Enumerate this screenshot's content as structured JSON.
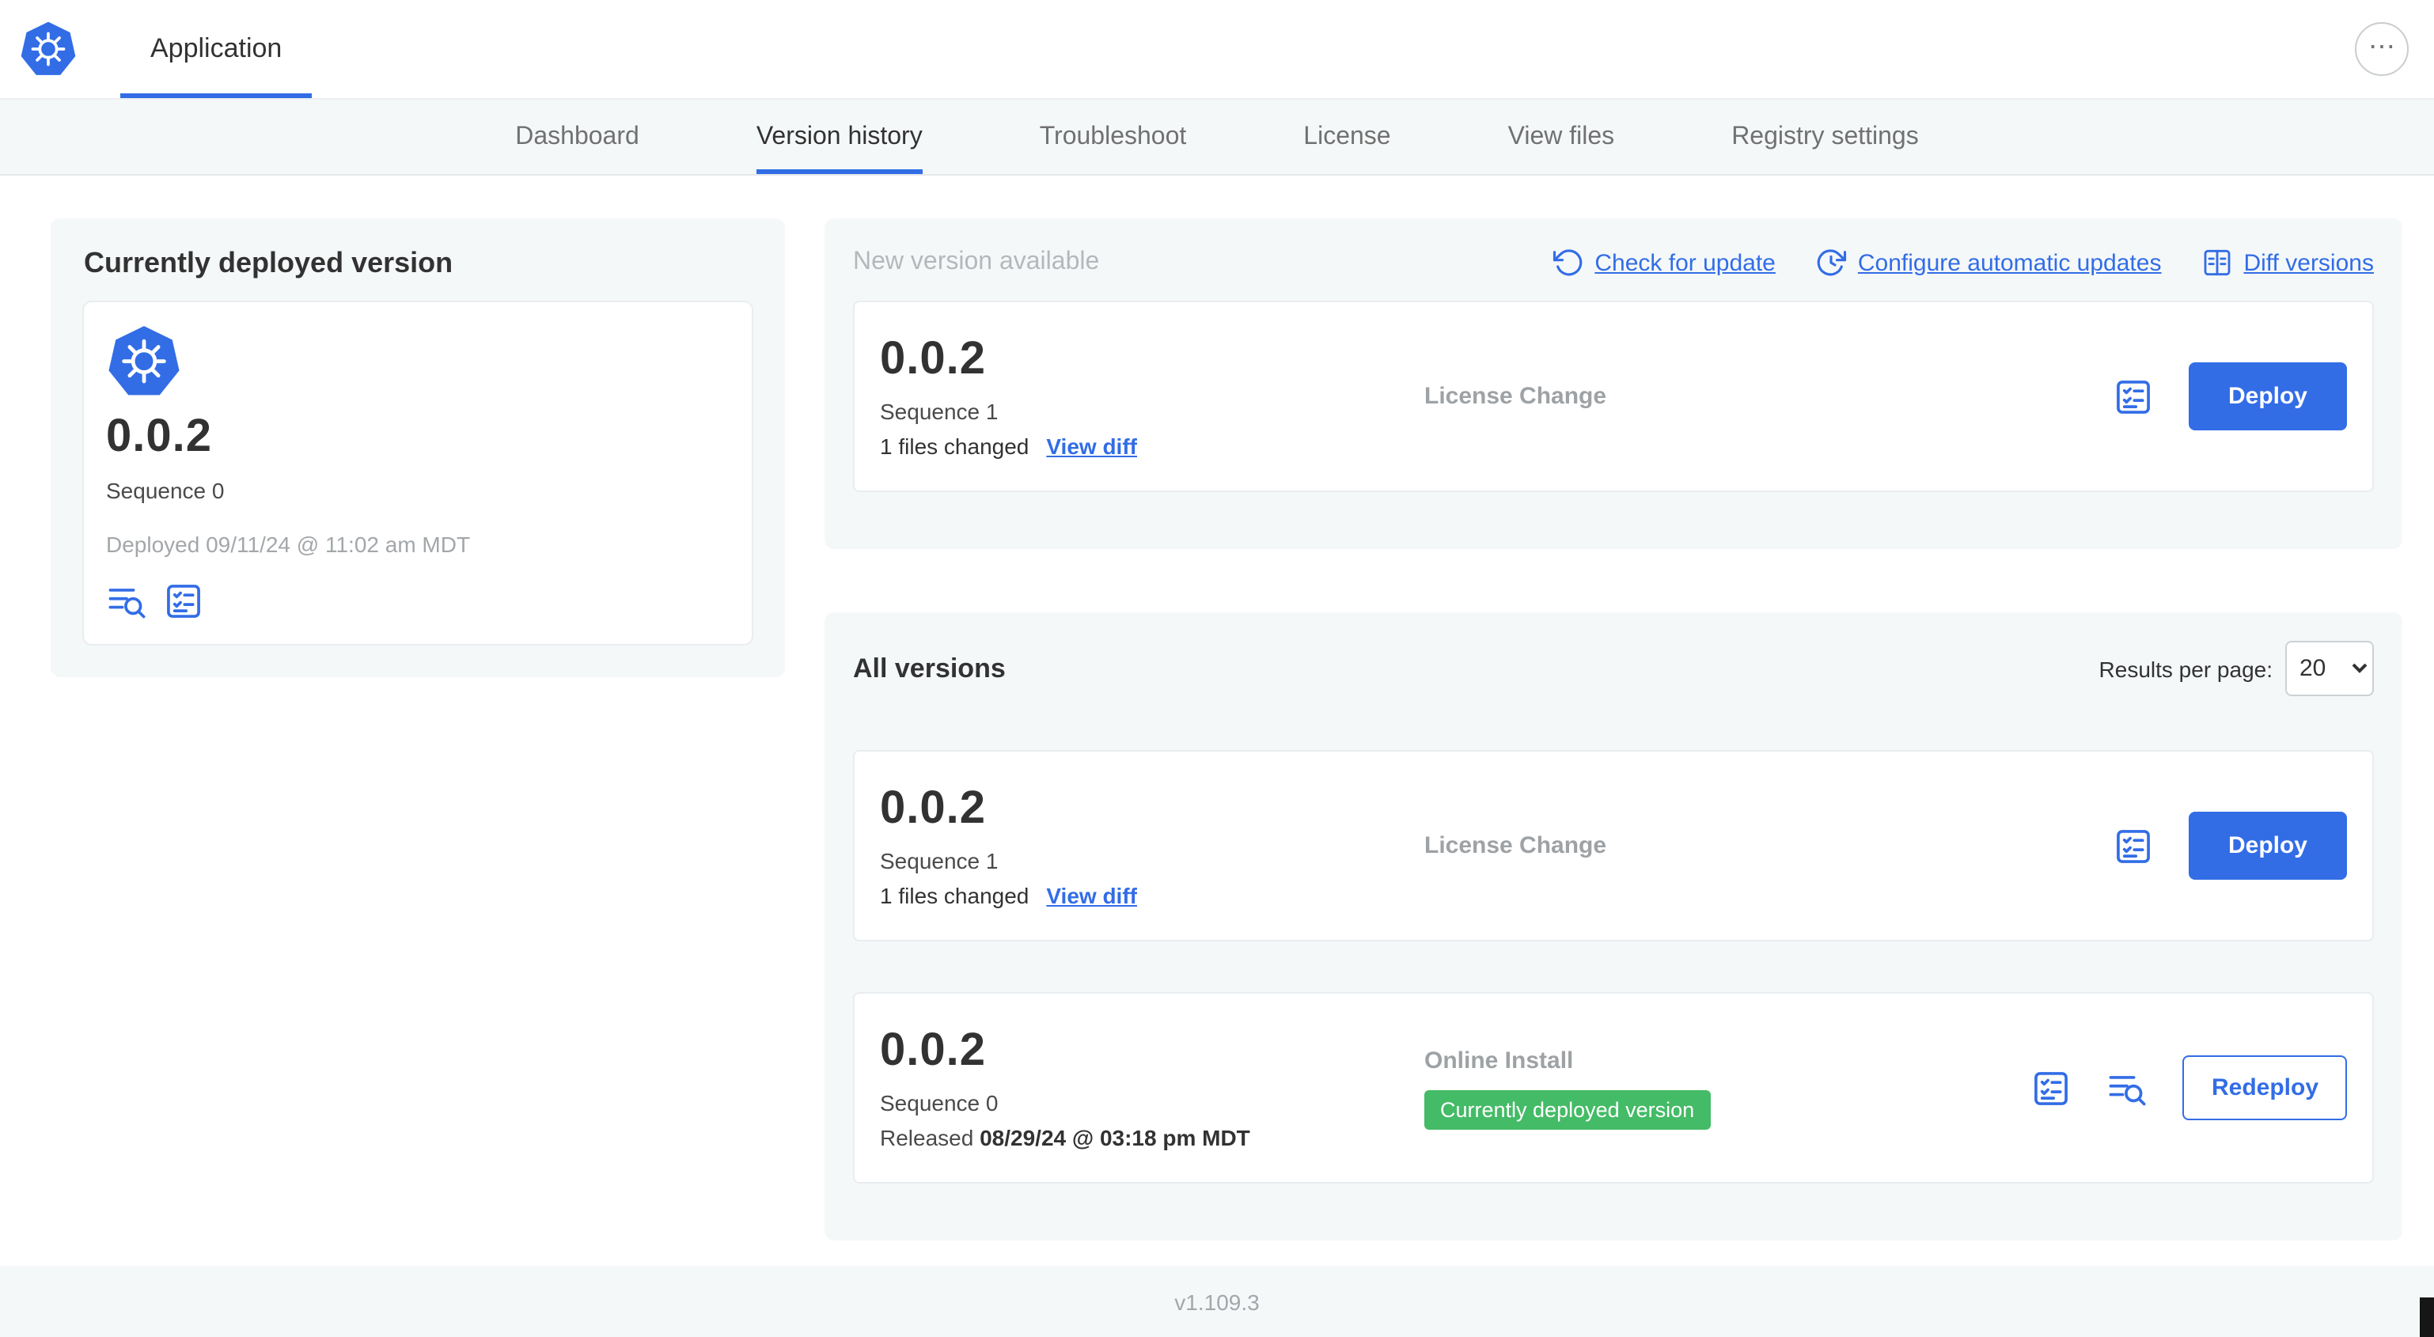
{
  "colors": {
    "accent_blue": "#326de6",
    "badge_green": "#44bb66",
    "panel_bg": "#f5f8f9",
    "muted_text": "#9ea2a5"
  },
  "icons": {
    "menu_glyph": "⋯",
    "app_logo": "kubernetes-wheel",
    "check_for_update": "rotate-ccw-arrow",
    "configure_updates": "clock-refresh",
    "diff_versions": "split-diff",
    "preflight_checks": "checklist",
    "release_notes": "lines-magnifier"
  },
  "header": {
    "app_tab_label": "Application"
  },
  "nav": {
    "tabs": [
      {
        "label": "Dashboard",
        "active": false
      },
      {
        "label": "Version history",
        "active": true
      },
      {
        "label": "Troubleshoot",
        "active": false
      },
      {
        "label": "License",
        "active": false
      },
      {
        "label": "View files",
        "active": false
      },
      {
        "label": "Registry settings",
        "active": false
      }
    ]
  },
  "current_version": {
    "title": "Currently deployed version",
    "version": "0.0.2",
    "sequence": "Sequence 0",
    "deployed_at": "Deployed 09/11/24 @ 11:02 am MDT"
  },
  "new_version": {
    "title": "New version available",
    "links": {
      "check_for_update": "Check for update",
      "configure_updates": "Configure automatic updates",
      "diff_versions": "Diff versions"
    },
    "card": {
      "version": "0.0.2",
      "sequence": "Sequence 1",
      "files_changed": "1 files changed",
      "view_diff": "View diff",
      "type": "License Change",
      "action_label": "Deploy"
    }
  },
  "all_versions": {
    "title": "All versions",
    "results_per_page_label": "Results per page:",
    "results_per_page_value": "20",
    "rows": [
      {
        "version": "0.0.2",
        "sequence": "Sequence 1",
        "files_changed": "1 files changed",
        "view_diff": "View diff",
        "type": "License Change",
        "action_label": "Deploy"
      },
      {
        "version": "0.0.2",
        "sequence": "Sequence 0",
        "released_prefix": "Released",
        "released_date": "08/29/24 @ 03:18 pm MDT",
        "type": "Online Install",
        "status_badge": "Currently deployed version",
        "action_label": "Redeploy"
      }
    ]
  },
  "footer": {
    "app_manager_version": "v1.109.3"
  }
}
